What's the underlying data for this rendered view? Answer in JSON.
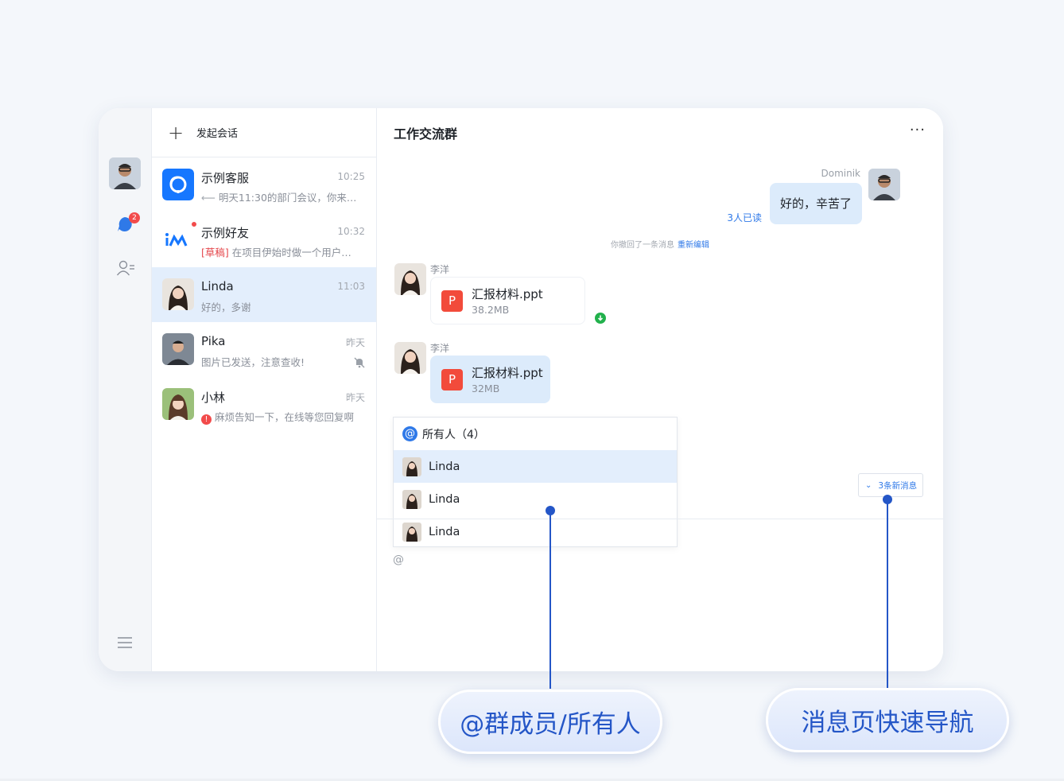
{
  "sidebar": {
    "unread_badge": "2",
    "icons": [
      "chat-icon",
      "contacts-icon",
      "menu-icon"
    ]
  },
  "conversation_list": {
    "new_label": "发起会话",
    "items": [
      {
        "name": "示例客服",
        "time": "10:25",
        "preview": "明天11:30的部门会议，你来…"
      },
      {
        "name": "示例好友",
        "time": "10:32",
        "draft_tag": "[草稿]",
        "preview": "在项目伊始时做一个用户…"
      },
      {
        "name": "Linda",
        "time": "11:03",
        "preview": "好的，多谢"
      },
      {
        "name": "Pika",
        "time": "昨天",
        "preview": "图片已发送，注意查收!"
      },
      {
        "name": "小林",
        "time": "昨天",
        "preview": "麻烦告知一下，在线等您回复啊"
      }
    ]
  },
  "chat": {
    "title": "工作交流群",
    "more": "···",
    "outgoing": {
      "sender": "Dominik",
      "text": "好的，辛苦了",
      "read_status": "3人已读"
    },
    "recall_notice": "你撤回了一条消息",
    "recall_action": "重新编辑",
    "file_messages": [
      {
        "sender": "李洋",
        "file_name": "汇报材料.ppt",
        "file_size": "38.2MB",
        "file_icon": "P"
      },
      {
        "sender": "李洋",
        "file_name": "汇报材料.ppt",
        "file_size": "32MB",
        "file_icon": "P"
      }
    ],
    "mention_picker": {
      "all_label": "所有人（4）",
      "members": [
        "Linda",
        "Linda",
        "Linda"
      ]
    },
    "new_messages": "3条新消息",
    "input_text": "@"
  },
  "callouts": {
    "left": "@群成员/所有人",
    "right": "消息页快速导航"
  },
  "colors": {
    "accent": "#2F79E8",
    "callout": "#2456C7",
    "active_row": "#E3EEFC",
    "badge": "#F24B4B"
  }
}
